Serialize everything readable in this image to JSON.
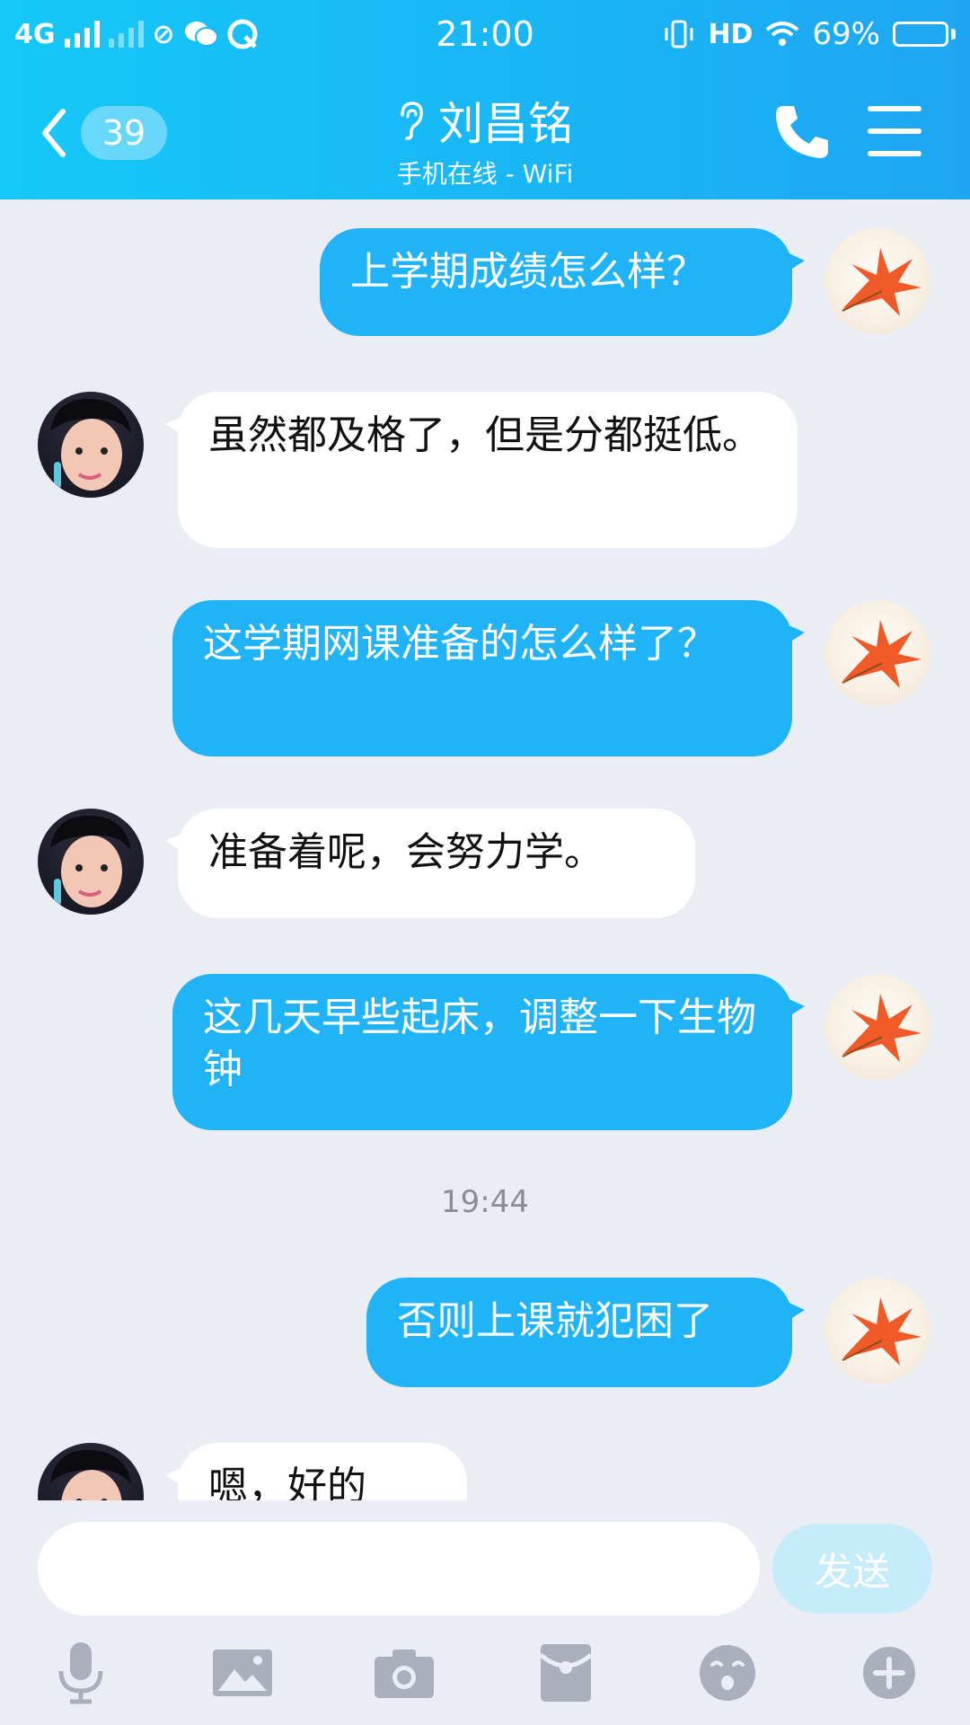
{
  "status_bar": {
    "network": "4G",
    "time": "21:00",
    "hd": "HD",
    "battery": "69%",
    "battery_level": 0.69
  },
  "header": {
    "unread_count": "39",
    "contact_name": "刘昌铭",
    "contact_status": "手机在线 - WiFi"
  },
  "messages": [
    {
      "from": "me",
      "text": "上学期成绩怎么样？"
    },
    {
      "from": "them",
      "text": "虽然都及格了，但是分都挺低。"
    },
    {
      "from": "me",
      "text": "这学期网课准备的怎么样了？"
    },
    {
      "from": "them",
      "text": "准备着呢，会努力学。"
    },
    {
      "from": "me",
      "text": "这几天早些起床，调整一下生物钟"
    },
    {
      "timestamp": "19:44"
    },
    {
      "from": "me",
      "text": "否则上课就犯困了"
    },
    {
      "from": "them",
      "text": "嗯，好的"
    }
  ],
  "input": {
    "value": "",
    "send_label": "发送"
  },
  "toolbar": [
    "microphone-icon",
    "image-icon",
    "camera-icon",
    "red-packet-icon",
    "emoji-icon",
    "plus-icon"
  ],
  "colors": {
    "header": "#19b6f6",
    "outgoing_bubble": "#21b3f7",
    "incoming_bubble": "#ffffff",
    "background": "#eaedf4",
    "send_disabled": "#c6ecfb"
  }
}
